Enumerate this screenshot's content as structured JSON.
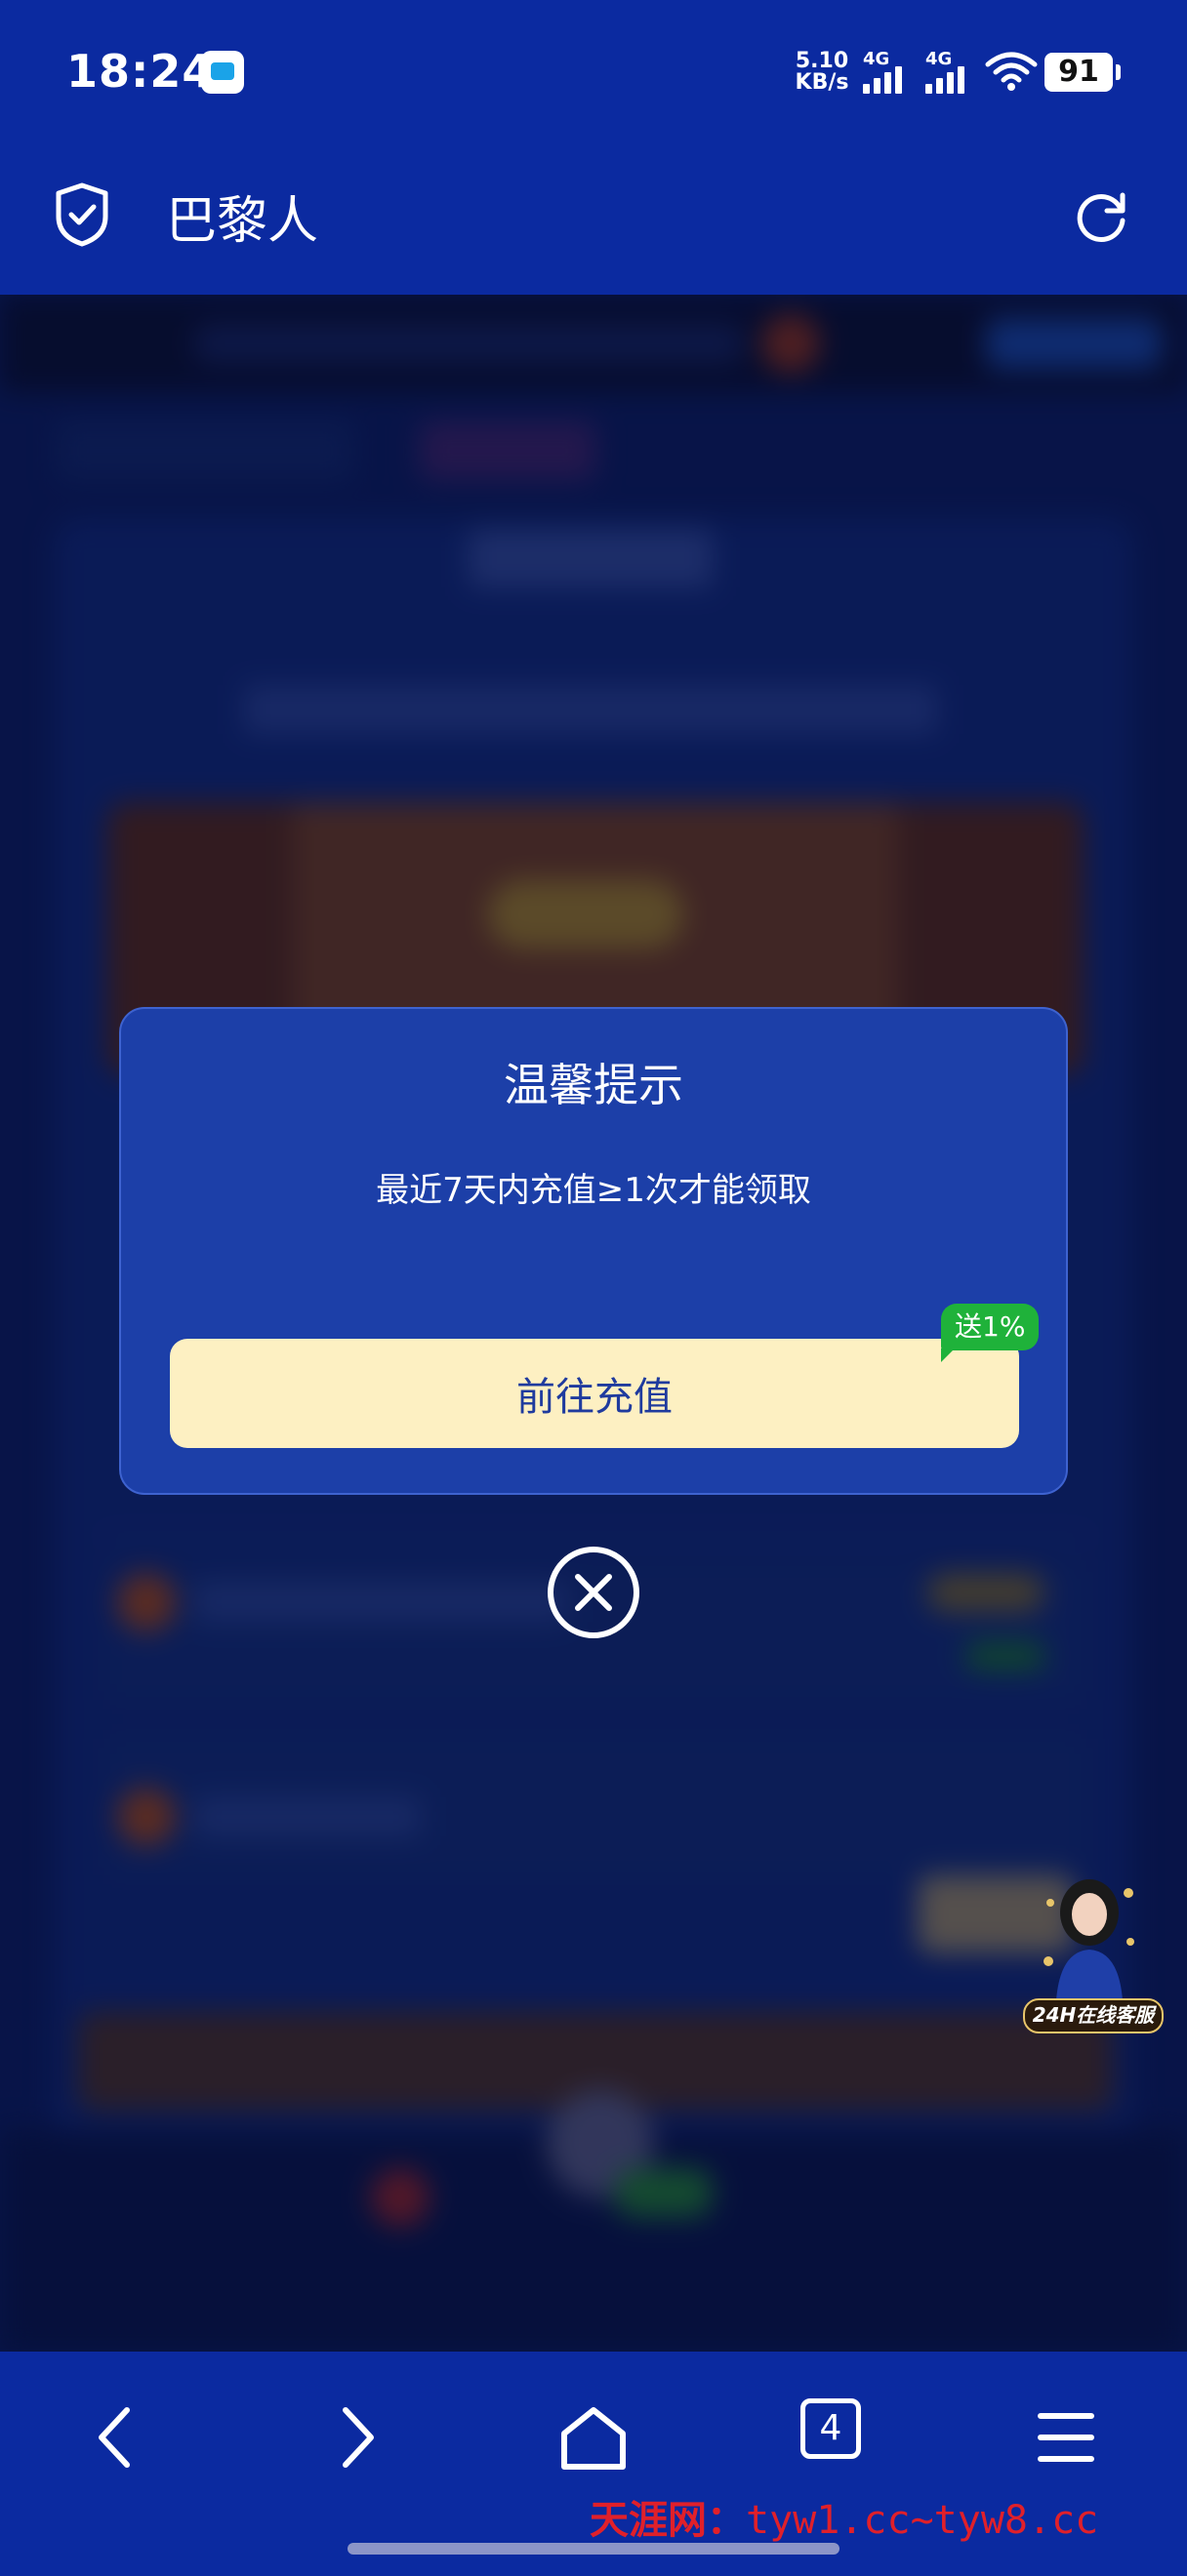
{
  "status_bar": {
    "time": "18:24",
    "net_speed_value": "5.10",
    "net_speed_unit": "KB/s",
    "signal1_label": "4G",
    "signal2_label": "4G",
    "battery": "91"
  },
  "header": {
    "title": "巴黎人"
  },
  "dialog": {
    "title": "温馨提示",
    "message": "最近7天内充值≥1次才能领取",
    "button_label": "前往充值",
    "badge": "送1%"
  },
  "customer_service": {
    "label": "24H在线客服"
  },
  "bottom_nav": {
    "tabs_count": "4",
    "watermark_text": "天涯网：",
    "watermark_url": "tyw1.cc~tyw8.cc"
  },
  "colors": {
    "chrome_blue": "#0b2aa0",
    "dialog_bg": "#1c3fa8",
    "button_bg": "#fdf0c2",
    "badge_green": "#1fb23a",
    "watermark_red": "#e0202a"
  }
}
